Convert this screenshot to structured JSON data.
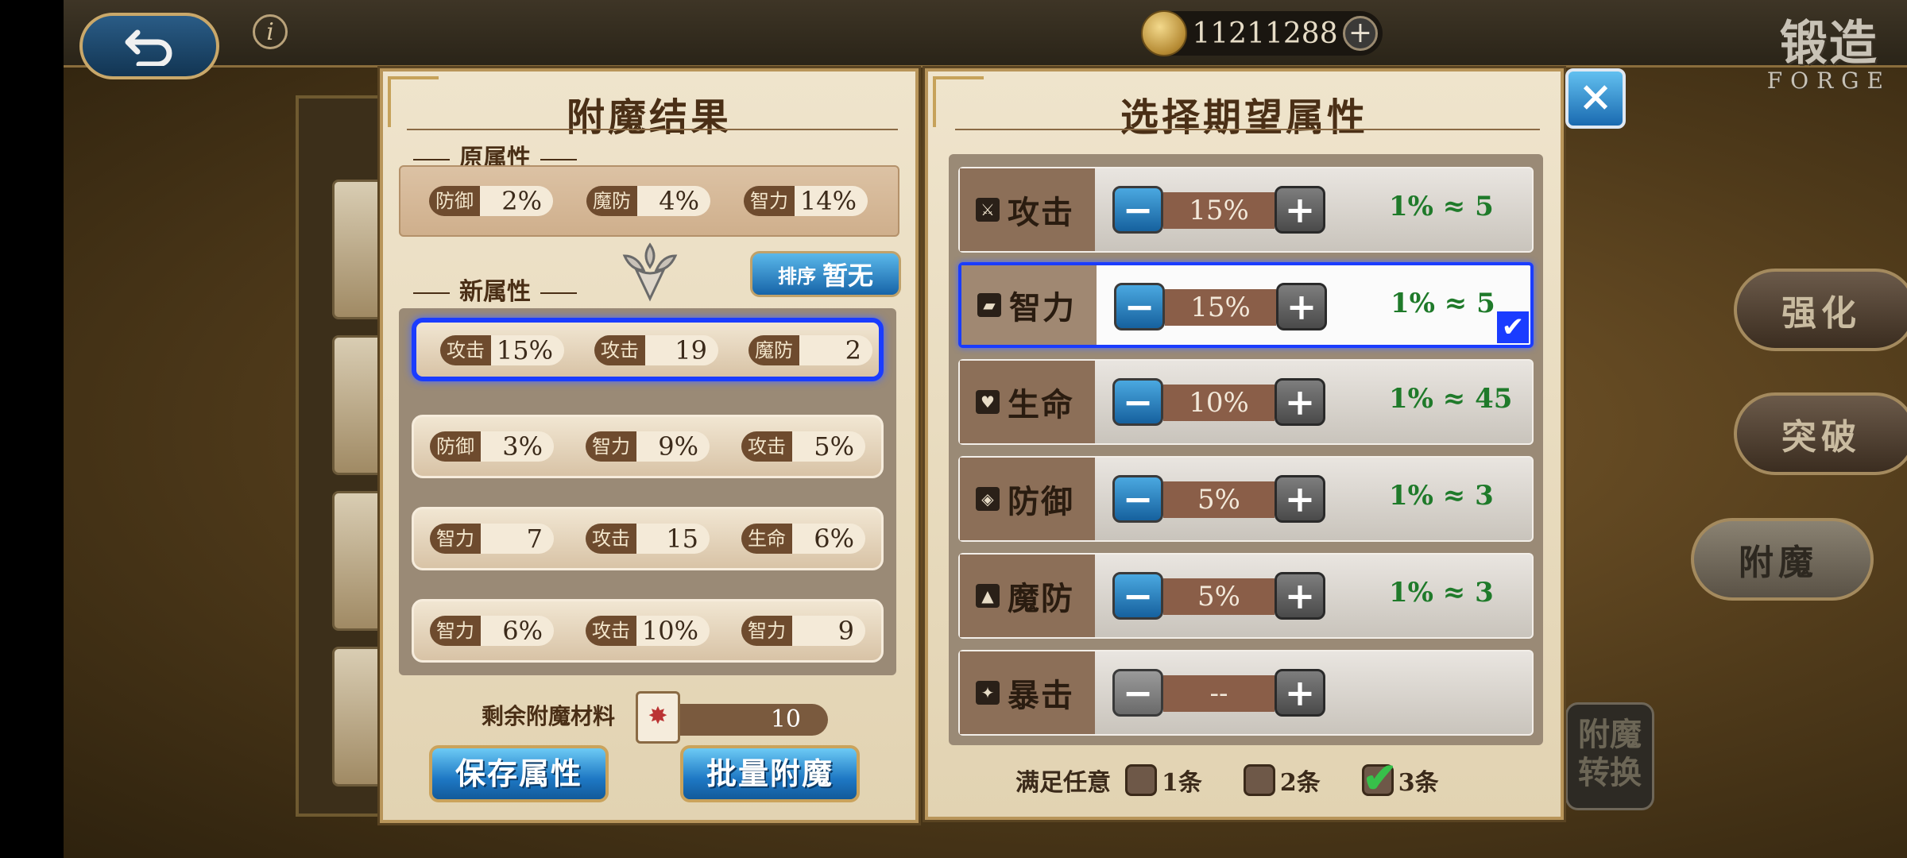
{
  "topbar": {
    "gold_value": "11211288",
    "gold_plus": "+",
    "forge_zh": "锻造",
    "forge_en": "FORGE",
    "info": "i"
  },
  "side_menu": [
    {
      "label": "强化",
      "active": false
    },
    {
      "label": "突破",
      "active": false
    },
    {
      "label": "附魔",
      "active": true
    }
  ],
  "convert_button": {
    "line1": "附魔",
    "line2": "转换"
  },
  "result_panel": {
    "title": "附魔结果",
    "original_label": "原属性",
    "original_stats": [
      {
        "name": "防御",
        "value": "2%"
      },
      {
        "name": "魔防",
        "value": "4%"
      },
      {
        "name": "智力",
        "value": "14%"
      }
    ],
    "new_label": "新属性",
    "sort": {
      "label": "排序",
      "value": "暂无"
    },
    "new_results": [
      {
        "selected": true,
        "stats": [
          {
            "name": "攻击",
            "value": "15%"
          },
          {
            "name": "攻击",
            "value": "19"
          },
          {
            "name": "魔防",
            "value": "2"
          }
        ]
      },
      {
        "selected": false,
        "stats": [
          {
            "name": "防御",
            "value": "3%"
          },
          {
            "name": "智力",
            "value": "9%"
          },
          {
            "name": "攻击",
            "value": "5%"
          }
        ]
      },
      {
        "selected": false,
        "stats": [
          {
            "name": "智力",
            "value": "7"
          },
          {
            "name": "攻击",
            "value": "15"
          },
          {
            "name": "生命",
            "value": "6%"
          }
        ]
      },
      {
        "selected": false,
        "stats": [
          {
            "name": "智力",
            "value": "6%"
          },
          {
            "name": "攻击",
            "value": "10%"
          },
          {
            "name": "智力",
            "value": "9"
          }
        ]
      }
    ],
    "material_label": "剩余附魔材料",
    "material_count": "10",
    "save_button": "保存属性",
    "batch_button": "批量附魔"
  },
  "select_panel": {
    "title": "选择期望属性",
    "close": "×",
    "options": [
      {
        "name": "攻击",
        "icon": "sword-icon",
        "pct": "15%",
        "eq": "1% ≈ 5",
        "selected": false,
        "minus_enabled": true
      },
      {
        "name": "智力",
        "icon": "book-icon",
        "pct": "15%",
        "eq": "1% ≈ 5",
        "selected": true,
        "minus_enabled": true
      },
      {
        "name": "生命",
        "icon": "heart-icon",
        "pct": "10%",
        "eq": "1% ≈ 45",
        "selected": false,
        "minus_enabled": true
      },
      {
        "name": "防御",
        "icon": "shield-icon",
        "pct": "5%",
        "eq": "1% ≈ 3",
        "selected": false,
        "minus_enabled": true
      },
      {
        "name": "魔防",
        "icon": "bell-icon",
        "pct": "5%",
        "eq": "1% ≈ 3",
        "selected": false,
        "minus_enabled": true
      },
      {
        "name": "暴击",
        "icon": "crit-icon",
        "pct": "--",
        "eq": "",
        "selected": false,
        "minus_enabled": false
      }
    ],
    "satisfy_label": "满足任意",
    "satisfy_options": [
      {
        "label": "1条",
        "checked": false
      },
      {
        "label": "2条",
        "checked": false
      },
      {
        "label": "3条",
        "checked": true
      }
    ]
  },
  "colors": {
    "selection": "#1a3cff",
    "blue_button": "#1e78c4",
    "equivalence_text": "#1f7a2a"
  }
}
